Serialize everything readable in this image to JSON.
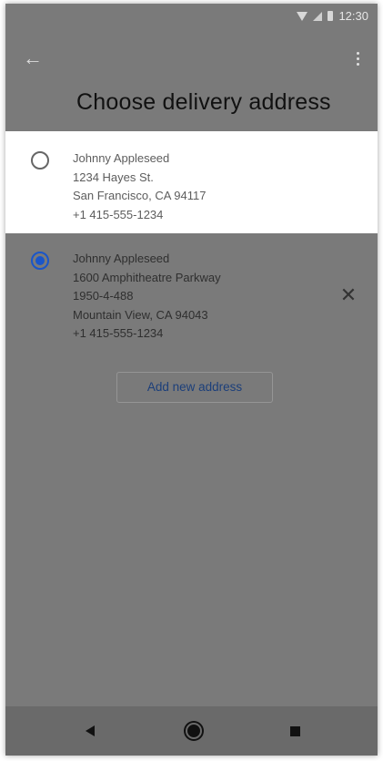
{
  "status_bar": {
    "time": "12:30"
  },
  "toolbar": {
    "back_icon": "arrow-back-icon",
    "overflow_icon": "more-vert-icon"
  },
  "page": {
    "title": "Choose delivery address"
  },
  "addresses": [
    {
      "selected": false,
      "lines": [
        "Johnny Appleseed",
        "1234 Hayes St.",
        "San Francisco, CA 94117",
        "+1 415-555-1234"
      ]
    },
    {
      "selected": true,
      "lines": [
        "Johnny Appleseed",
        "1600 Amphitheatre Parkway",
        "1950-4-488",
        "Mountain View, CA 94043",
        "+1 415-555-1234"
      ],
      "delete_icon": "close-icon"
    }
  ],
  "actions": {
    "add_address_label": "Add new address"
  },
  "colors": {
    "accent": "#1a56c9",
    "scrim": "#7a7a7a",
    "link_text": "#1c3f7a"
  },
  "nav_bar": {
    "back_icon": "nav-back-icon",
    "home_icon": "nav-home-icon",
    "recents_icon": "nav-recents-icon"
  }
}
